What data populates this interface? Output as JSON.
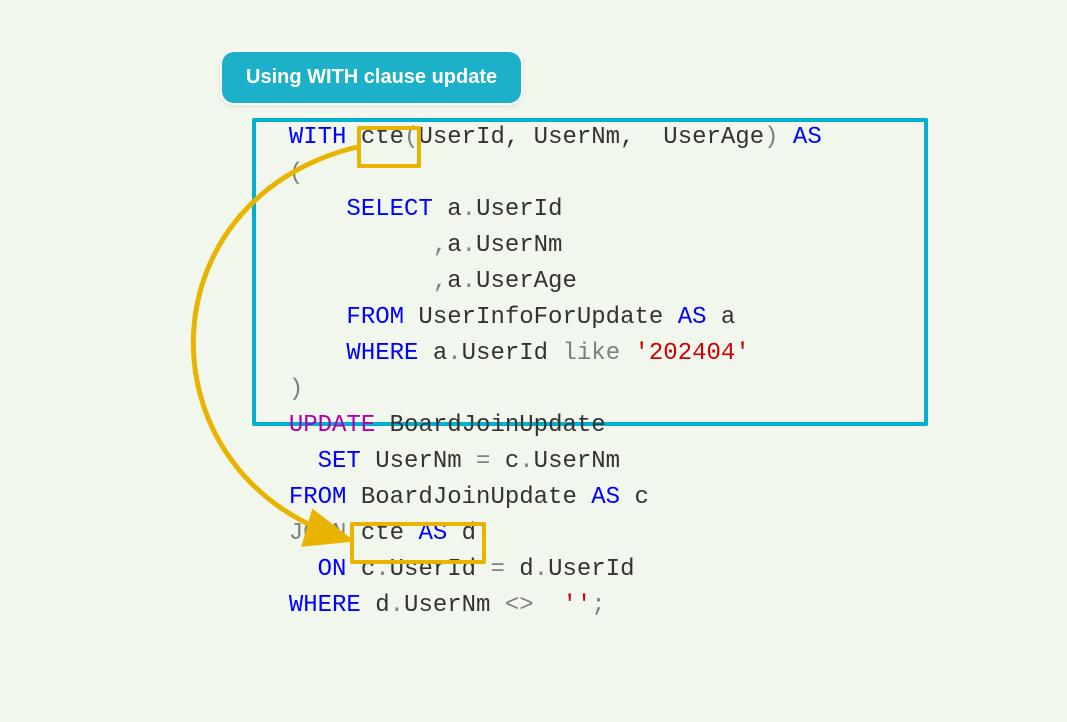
{
  "badge": {
    "label": "Using WITH clause update"
  },
  "code": {
    "l1": {
      "with": "WITH",
      "cte": "cte",
      "open": "(",
      "cols": "UserId, UserNm,  UserAge",
      "close": ")",
      "as": "AS"
    },
    "l2": {
      "paren": "("
    },
    "l3": {
      "select": "SELECT",
      "a1": " a",
      "dot1": ".",
      "c1": "UserId"
    },
    "l4": {
      "comma": ",",
      "a": "a",
      "dot": ".",
      "c": "UserNm"
    },
    "l5": {
      "comma": ",",
      "a": "a",
      "dot": ".",
      "c": "UserAge"
    },
    "l6": {
      "from": "FROM",
      "tbl": " UserInfoForUpdate ",
      "as": "AS",
      "alias": " a"
    },
    "l7": {
      "where": "WHERE",
      "a": " a",
      "dot": ".",
      "col": "UserId ",
      "like": "like",
      "lit": " '202404'"
    },
    "l8": {
      "paren": ")"
    },
    "l9": {
      "update": "UPDATE",
      "tbl": " BoardJoinUpdate"
    },
    "l10": {
      "set": "SET",
      "lhs": " UserNm ",
      "eq": "=",
      "rhs_a": " c",
      "rhs_d": ".",
      "rhs_c": "UserNm"
    },
    "l11": {
      "from": "FROM",
      "tbl": " BoardJoinUpdate ",
      "as": "AS",
      "alias": " c"
    },
    "l12": {
      "join": "JOIN",
      "cte": " cte ",
      "as": "AS",
      "alias": " d"
    },
    "l13": {
      "on": "ON",
      "c": " c",
      "d1": ".",
      "col1": "UserId ",
      "eq": "=",
      "d": " d",
      "d2": ".",
      "col2": "UserId"
    },
    "l14": {
      "where": "WHERE",
      "d": " d",
      "dot": ".",
      "col": "UserNm ",
      "op": "<>",
      "lit": "  ''",
      "semi": ";"
    }
  }
}
